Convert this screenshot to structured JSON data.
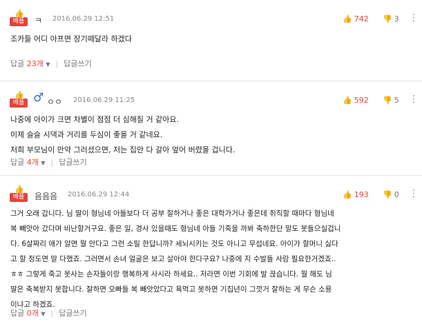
{
  "badge_label": "베플",
  "reply_label": "답글",
  "write_reply_label": "답글쓰기",
  "reply_suffix": "개",
  "more_icon": "more-icon",
  "comments": [
    {
      "nick": "ㅋ",
      "date": "2016.06.29 12:51",
      "likes": "742",
      "dislikes": "3",
      "lines": [
        "조카들 어디 아프면 장기떼달라 하겠다"
      ],
      "reply_count": "23"
    },
    {
      "gender_icon": "♂",
      "nick": "ㅇㅇ",
      "date": "2016.06.29 11:25",
      "likes": "592",
      "dislikes": "5",
      "lines": [
        "나중에 아이가 크면 차별이 점점 더 심해질 거 같아요.",
        "이제 슬슬 시댁과 거리를 두심이 좋을 거 같네요.",
        "저희 부모님이 만약 그러셨으면, 저는 집안 다 갈아 엎어 버렸을 겁니다."
      ],
      "reply_count": "4"
    },
    {
      "nick": "음음음",
      "date": "2016.06.29 12:44",
      "likes": "193",
      "dislikes": "0",
      "lines": [
        "그거 오래 갑니다. 님 딸이 형님네 아들보다 더 공부 잘하거나 좋은 대학가거나 좋은데 취직할 때마다 형님네",
        "복 빼앗아 갔다며 비난할거구요. 좋은 일, 경사 있을때도 형님네 아들 기죽을 까봐 축하한단 말도 못들으실겁니",
        "다. 6살짜리 애가 알면 뭘 안다고 그런 소릴 한답니까? 세뇌시키는 것도 아니고 무섭네요. 아이가 할머니 싫다",
        "고 할 정도면 말 다했죠. 그러면서 손녀 얼굴은 보고 살아야 한다구요? 나중에 지 수발들 사람 필요한거겠죠..",
        "ㅎㅎ 그렇게 죽고 못사는 손자들이랑 행복하게 사시라 하세요.. 저라면 이번 기회에 발 끊습니다. 뭘 해도 님",
        "딸은 축복받지 못합니다. 잘하면 오빠들 복 빼앗았다고 욕먹고 못하면 기집년이 그깟거 잘하는 게 무슨 소용",
        "이냐고 하겠죠."
      ],
      "reply_count": "0"
    }
  ]
}
